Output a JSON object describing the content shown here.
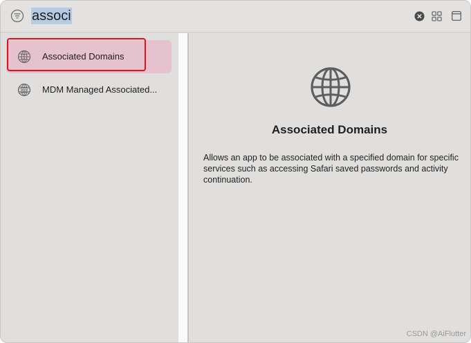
{
  "search": {
    "query": "associ"
  },
  "sidebar": {
    "items": [
      {
        "label": "Associated Domains",
        "icon": "globe-icon",
        "selected": true
      },
      {
        "label": "MDM Managed Associated...",
        "icon": "mdm-globe-icon",
        "badge": "MDM",
        "selected": false
      }
    ]
  },
  "detail": {
    "icon": "globe-icon",
    "title": "Associated Domains",
    "description": "Allows an app to be associated with a specified domain for specific services such as accessing Safari saved passwords and activity continuation."
  },
  "watermark": "CSDN @AiFlutter",
  "colors": {
    "selection": "#e6c2ce",
    "annotation": "#e4101b",
    "search_highlight": "#b5cbe4"
  }
}
